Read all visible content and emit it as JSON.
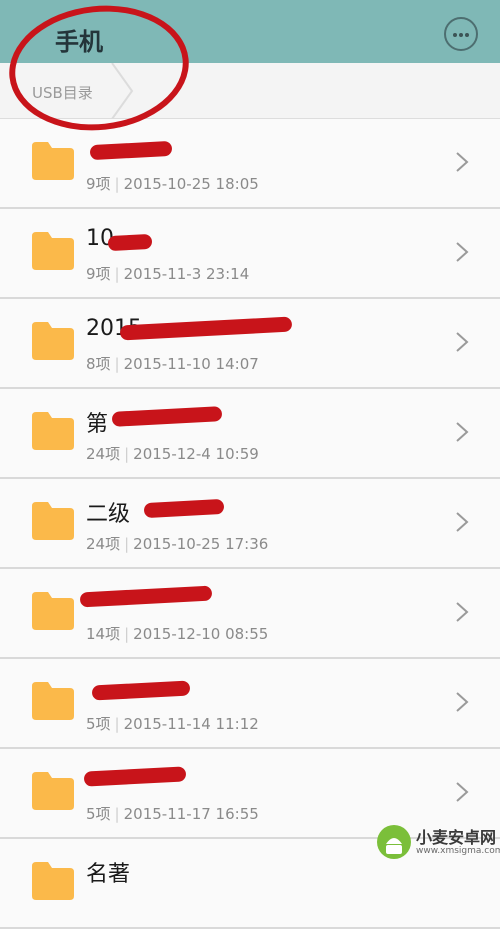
{
  "header": {
    "title": "手机",
    "more_icon": "more-dots-icon"
  },
  "breadcrumb": {
    "current": "USB目录"
  },
  "folders": [
    {
      "name": "",
      "count": "9项",
      "date": "2015-10-25 18:05"
    },
    {
      "name": "10",
      "count": "9项",
      "date": "2015-11-3 23:14"
    },
    {
      "name": "2015",
      "count": "8项",
      "date": "2015-11-10 14:07"
    },
    {
      "name": "第",
      "count": "24项",
      "date": "2015-12-4 10:59"
    },
    {
      "name": "二级",
      "count": "24项",
      "date": "2015-10-25 17:36"
    },
    {
      "name": "",
      "count": "14项",
      "date": "2015-12-10 08:55"
    },
    {
      "name": "",
      "count": "5项",
      "date": "2015-11-14 11:12"
    },
    {
      "name": "",
      "count": "5项",
      "date": "2015-11-17 16:55"
    },
    {
      "name": "名著",
      "count": "",
      "date": ""
    }
  ],
  "watermark": {
    "title": "小麦安卓网",
    "url": "www.xmsigma.com"
  },
  "colors": {
    "header": "#7fb8b6",
    "folder": "#fbb94a",
    "annotation": "#c8141a"
  }
}
